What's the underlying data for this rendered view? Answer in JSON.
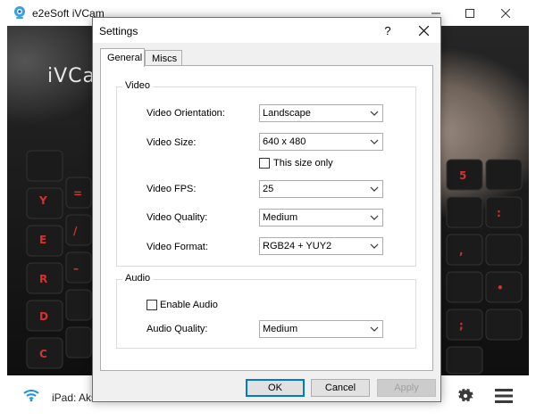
{
  "main_window": {
    "title": "e2eSoft iVCam",
    "watermark": "iVCa",
    "device_label": "iPad: Aks"
  },
  "dialog": {
    "title": "Settings",
    "help_label": "?",
    "tabs": [
      {
        "label": "General",
        "active": true
      },
      {
        "label": "Miscs",
        "active": false
      }
    ],
    "video_group": {
      "title": "Video",
      "orientation": {
        "label": "Video Orientation:",
        "value": "Landscape"
      },
      "size": {
        "label": "Video Size:",
        "value": "640 x 480"
      },
      "size_only": {
        "label": "This size only",
        "checked": false
      },
      "fps": {
        "label": "Video FPS:",
        "value": "25"
      },
      "quality": {
        "label": "Video Quality:",
        "value": "Medium"
      },
      "format": {
        "label": "Video Format:",
        "value": "RGB24 + YUY2"
      }
    },
    "audio_group": {
      "title": "Audio",
      "enable": {
        "label": "Enable Audio",
        "checked": false
      },
      "quality": {
        "label": "Audio Quality:",
        "value": "Medium"
      }
    },
    "buttons": {
      "ok": "OK",
      "cancel": "Cancel",
      "apply": "Apply"
    }
  },
  "colors": {
    "accent": "#0078d7",
    "wifi": "#1e90e0",
    "keyboard_glow": "#d83030"
  },
  "icons": {
    "app": "camera-logo-icon",
    "wifi": "wifi-icon",
    "gear": "gear-icon",
    "menu": "hamburger-menu-icon",
    "close": "close-icon",
    "minimize": "minimize-icon",
    "maximize": "maximize-icon",
    "dropdown": "chevron-down-icon"
  }
}
